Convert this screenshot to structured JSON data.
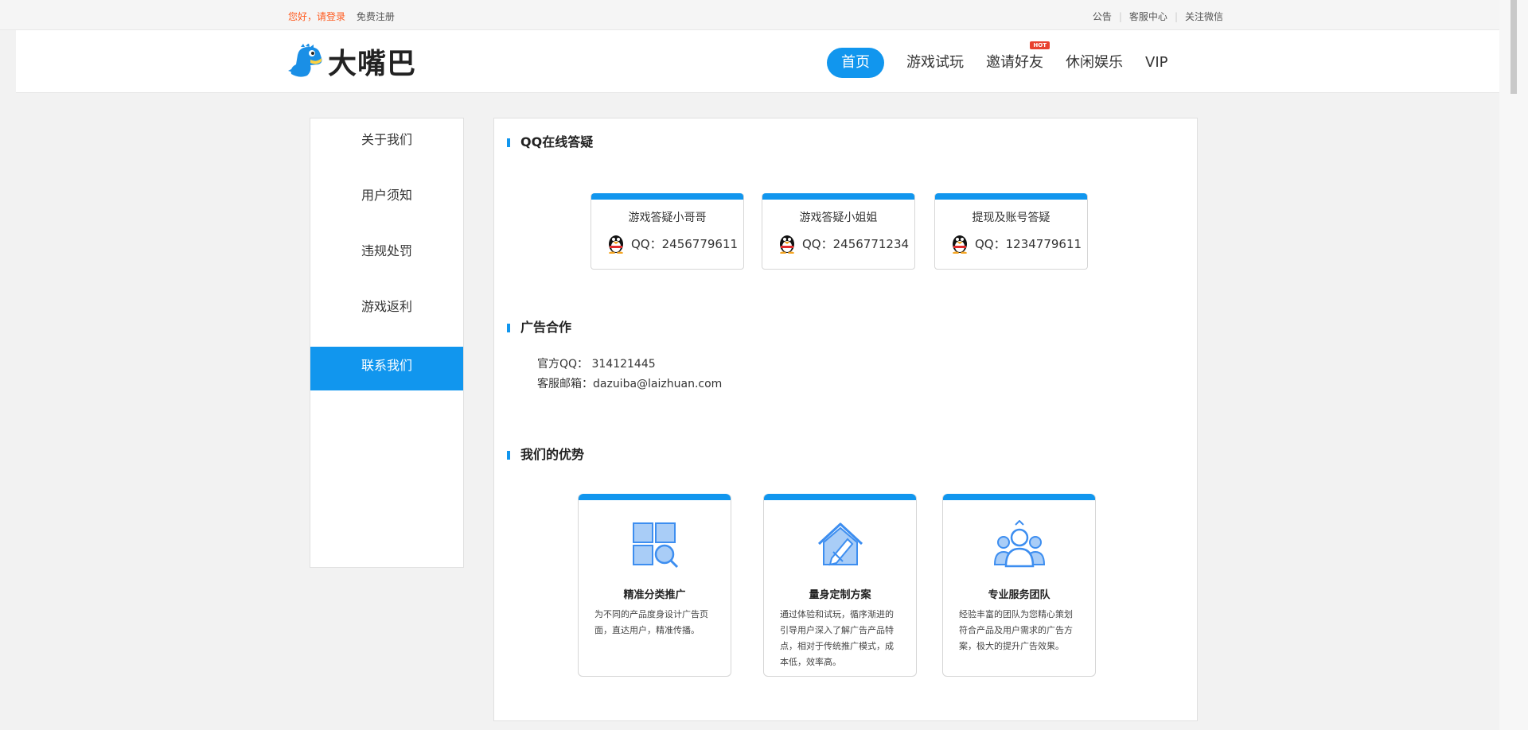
{
  "topbar": {
    "login": "您好，请登录",
    "register": "免费注册",
    "links": [
      "公告",
      "客服中心",
      "关注微信"
    ]
  },
  "header": {
    "logo_text": "大嘴巴",
    "nav": [
      {
        "label": "首页",
        "active": true
      },
      {
        "label": "游戏试玩",
        "active": false
      },
      {
        "label": "邀请好友",
        "active": false,
        "badge": "HOT"
      },
      {
        "label": "休闲娱乐",
        "active": false
      },
      {
        "label": "VIP",
        "active": false
      }
    ]
  },
  "sidebar": {
    "items": [
      {
        "label": "关于我们"
      },
      {
        "label": "用户须知"
      },
      {
        "label": "违规处罚"
      },
      {
        "label": "游戏返利"
      },
      {
        "label": "联系我们",
        "active": true
      }
    ]
  },
  "main": {
    "qq_section_title": "QQ在线答疑",
    "qq_cards": [
      {
        "name": "游戏答疑小哥哥",
        "qq": "QQ：2456779611"
      },
      {
        "name": "游戏答疑小姐姐",
        "qq": "QQ：2456771234"
      },
      {
        "name": "提现及账号答疑",
        "qq": "QQ：1234779611"
      }
    ],
    "ad_section_title": "广告合作",
    "ad_qq": "官方QQ：  314121445",
    "ad_email": "客服邮箱：dazuiba@laizhuan.com",
    "adv_section_title": "我们的优势",
    "adv_cards": [
      {
        "icon": "grid-search-icon",
        "title": "精准分类推广",
        "desc": "为不同的产品度身设计广告页面，直达用户，精准传播。"
      },
      {
        "icon": "house-pencil-icon",
        "title": "量身定制方案",
        "desc": "通过体验和试玩，循序渐进的引导用户深入了解广告产品特点，相对于传统推广模式，成本低，效率高。"
      },
      {
        "icon": "team-icon",
        "title": "专业服务团队",
        "desc": "经验丰富的团队为您精心策划符合产品及用户需求的广告方案，极大的提升广告效果。"
      }
    ]
  },
  "colors": {
    "accent": "#1196ee",
    "login": "#ff5a1e",
    "hot": "#e8422f"
  }
}
